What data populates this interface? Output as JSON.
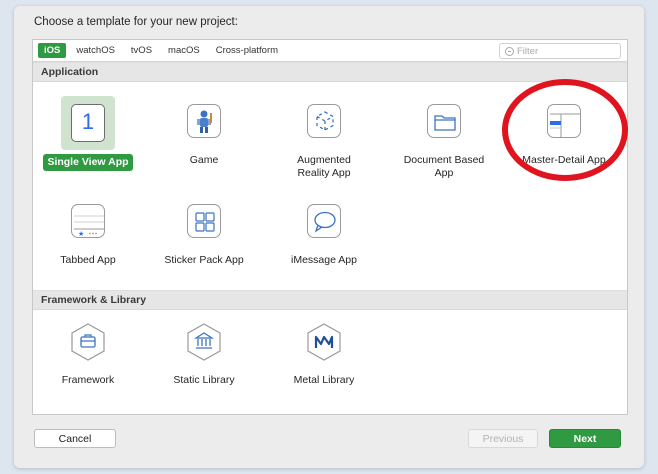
{
  "prompt": "Choose a template for your new project:",
  "platform_tabs": [
    {
      "label": "iOS",
      "active": true
    },
    {
      "label": "watchOS",
      "active": false
    },
    {
      "label": "tvOS",
      "active": false
    },
    {
      "label": "macOS",
      "active": false
    },
    {
      "label": "Cross-platform",
      "active": false
    }
  ],
  "filter": {
    "placeholder": "Filter"
  },
  "sections": {
    "application": "Application",
    "framework": "Framework & Library"
  },
  "templates": {
    "single_view": {
      "label": "Single View App",
      "icon": "number-one-icon",
      "glyph": "1"
    },
    "game": {
      "label": "Game",
      "icon": "game-icon"
    },
    "ar": {
      "label": "Augmented\nReality App",
      "icon": "ar-cube-icon"
    },
    "document": {
      "label": "Document Based\nApp",
      "icon": "folder-icon"
    },
    "master_detail": {
      "label": "Master-Detail App",
      "icon": "split-view-icon"
    },
    "tabbed": {
      "label": "Tabbed App",
      "icon": "tab-bar-icon"
    },
    "sticker": {
      "label": "Sticker Pack App",
      "icon": "grid-icon"
    },
    "imessage": {
      "label": "iMessage App",
      "icon": "speech-bubble-icon"
    },
    "framework": {
      "label": "Framework",
      "icon": "toolbox-icon"
    },
    "static_lib": {
      "label": "Static Library",
      "icon": "library-building-icon"
    },
    "metal_lib": {
      "label": "Metal Library",
      "icon": "metal-icon"
    }
  },
  "buttons": {
    "cancel": "Cancel",
    "previous": "Previous",
    "next": "Next"
  },
  "colors": {
    "accent": "#2f9a42",
    "annotation": "#e0141e",
    "icon_blue": "#2b6ee8"
  }
}
